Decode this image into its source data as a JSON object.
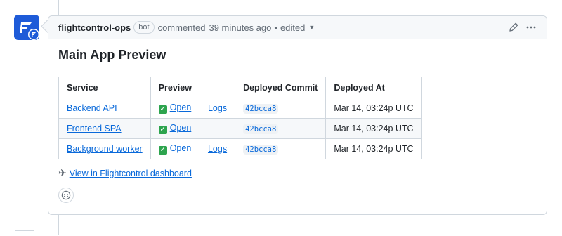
{
  "comment": {
    "author": "flightcontrol-ops",
    "badge": "bot",
    "action": "commented",
    "time": "39 minutes ago",
    "separator": "•",
    "edited": "edited",
    "more_icon": "kebab-horizontal-icon",
    "edit_icon": "pencil-icon"
  },
  "body": {
    "title": "Main App Preview",
    "table": {
      "headers": [
        "Service",
        "Preview",
        "",
        "Deployed Commit",
        "Deployed At"
      ],
      "rows": [
        {
          "service": "Backend API",
          "preview_icon": "✅",
          "preview": "Open",
          "logs": "Logs",
          "commit": "42bcca8",
          "deployed_at": "Mar 14, 03:24p UTC"
        },
        {
          "service": "Frontend SPA",
          "preview_icon": "✅",
          "preview": "Open",
          "logs": "",
          "commit": "42bcca8",
          "deployed_at": "Mar 14, 03:24p UTC"
        },
        {
          "service": "Background worker",
          "preview_icon": "✅",
          "preview": "Open",
          "logs": "Logs",
          "commit": "42bcca8",
          "deployed_at": "Mar 14, 03:24p UTC"
        }
      ]
    },
    "dashboard_icon": "✈️",
    "dashboard_link": "View in Flightcontrol dashboard",
    "reaction_icon": "smiley-icon"
  },
  "colors": {
    "accent": "#0969da",
    "brand": "#1e5bd8",
    "success": "#2da44e",
    "border": "#d0d7de"
  }
}
